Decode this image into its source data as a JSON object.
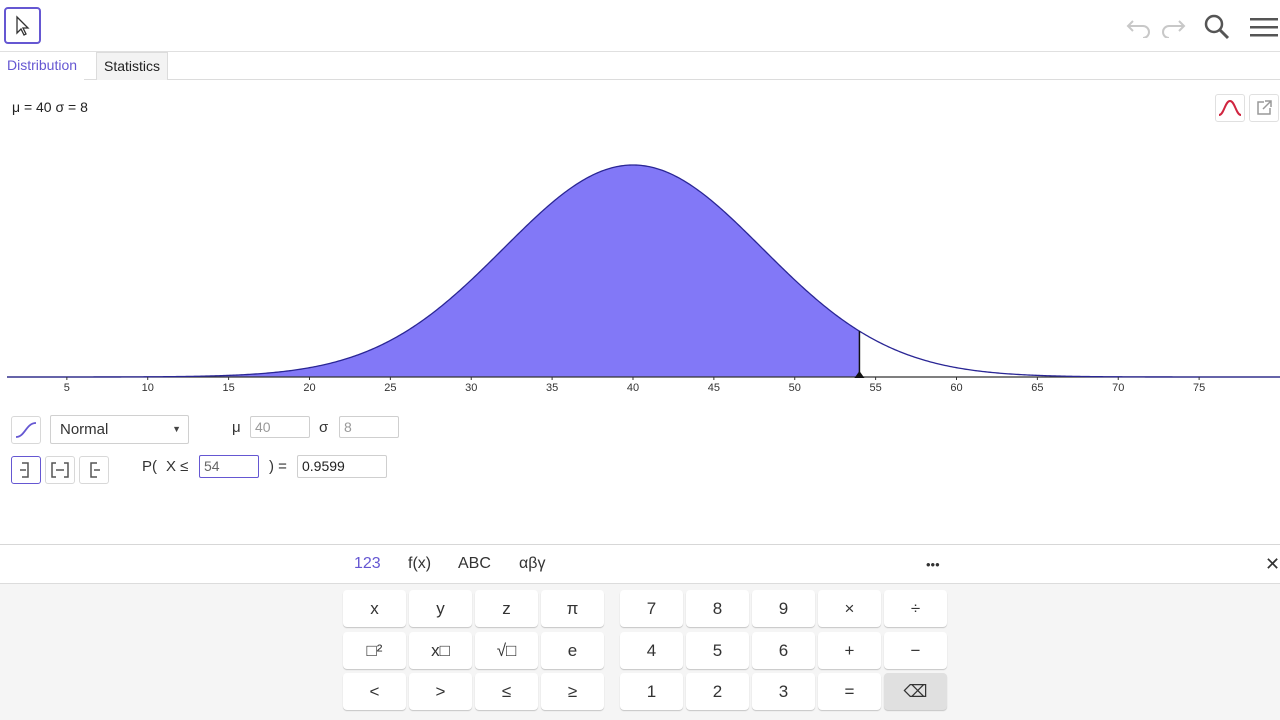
{
  "toolbar": {
    "move_tool": "move-tool",
    "undo": "undo",
    "redo": "redo",
    "search": "search",
    "menu": "menu"
  },
  "tabs": [
    {
      "label": "Distribution",
      "active": true
    },
    {
      "label": "Statistics",
      "active": false
    }
  ],
  "params_display": "μ = 40 σ = 8",
  "chart_data": {
    "type": "area",
    "distribution": "Normal",
    "mean": 40,
    "sd": 8,
    "shaded_upper_bound": 54,
    "x_ticks": [
      5,
      10,
      15,
      20,
      25,
      30,
      35,
      40,
      45,
      50,
      55,
      60,
      65,
      70,
      75
    ],
    "xlim": [
      1.3,
      80
    ],
    "colors": {
      "fill": "#8278f7",
      "curve": "#2a2695"
    }
  },
  "controls": {
    "distribution_select": "Normal",
    "mu_label": "μ",
    "mu_value": "40",
    "sigma_label": "σ",
    "sigma_value": "8",
    "prob_prefix": "P(",
    "prob_var": "X ≤",
    "prob_bound": "54",
    "prob_close": ") =",
    "prob_result": "0.9599"
  },
  "keyboard": {
    "tabs": [
      {
        "label": "123",
        "active": true
      },
      {
        "label": "f(x)",
        "active": false
      },
      {
        "label": "ABC",
        "active": false
      },
      {
        "label": "αβγ",
        "active": false
      }
    ],
    "more": "•••",
    "close": "✕",
    "rows": [
      [
        "x",
        "y",
        "z",
        "π",
        "7",
        "8",
        "9",
        "×",
        "÷"
      ],
      [
        "□²",
        "x□",
        "√□",
        "e",
        "4",
        "5",
        "6",
        "+",
        "−"
      ],
      [
        "<",
        ">",
        "≤",
        "≥",
        "1",
        "2",
        "3",
        "=",
        "⌫"
      ]
    ]
  }
}
